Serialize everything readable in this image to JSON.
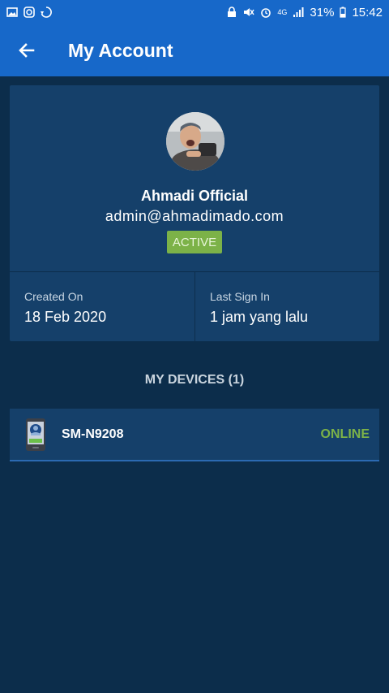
{
  "status_bar": {
    "battery": "31%",
    "time": "15:42",
    "network": "4G"
  },
  "app_bar": {
    "title": "My Account"
  },
  "profile": {
    "name": "Ahmadi Official",
    "email": "admin@ahmadimado.com",
    "status": "ACTIVE",
    "created_on_label": "Created On",
    "created_on_value": "18 Feb 2020",
    "last_sign_in_label": "Last Sign In",
    "last_sign_in_value": "1 jam yang lalu"
  },
  "devices": {
    "section_title": "MY DEVICES (1)",
    "items": [
      {
        "name": "SM-N9208",
        "status": "ONLINE"
      }
    ]
  },
  "colors": {
    "primary": "#1768c9",
    "background": "#0c2d4b",
    "card": "#15406a",
    "success": "#7cb248"
  }
}
